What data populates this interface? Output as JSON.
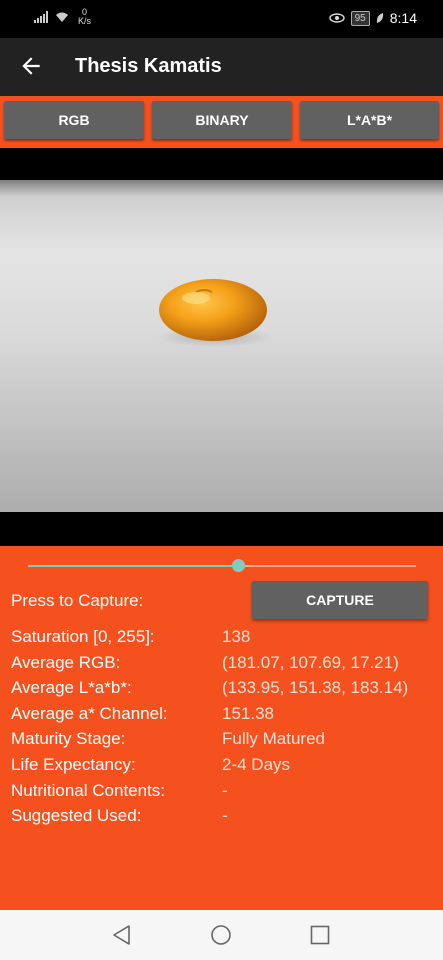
{
  "status": {
    "net_rate_value": "0",
    "net_rate_unit": "K/s",
    "battery": "95",
    "time": "8:14"
  },
  "appbar": {
    "title": "Thesis Kamatis"
  },
  "tabs": [
    {
      "label": "RGB"
    },
    {
      "label": "BINARY"
    },
    {
      "label": "L*A*B*"
    }
  ],
  "slider": {
    "value_fraction": 0.54
  },
  "capture": {
    "prompt": "Press to Capture:",
    "button_label": "CAPTURE"
  },
  "results": [
    {
      "label": "Saturation [0, 255]:",
      "value": "138"
    },
    {
      "label": "Average RGB:",
      "value": "(181.07, 107.69, 17.21)"
    },
    {
      "label": "Average L*a*b*:",
      "value": "(133.95, 151.38, 183.14)"
    },
    {
      "label": "Average a* Channel:",
      "value": "151.38"
    },
    {
      "label": "Maturity Stage:",
      "value": "Fully Matured"
    },
    {
      "label": "Life Expectancy:",
      "value": "2-4 Days"
    },
    {
      "label": "Nutritional Contents:",
      "value": "-"
    },
    {
      "label": "Suggested Used:",
      "value": "-"
    }
  ],
  "colors": {
    "accent": "#f4511e",
    "button": "#616161",
    "appbar": "#222222",
    "slider": "#80cbc4"
  },
  "icons": {
    "back": "arrow-left-icon",
    "nav_back": "triangle-back-icon",
    "nav_home": "circle-home-icon",
    "nav_recent": "square-recent-icon"
  }
}
